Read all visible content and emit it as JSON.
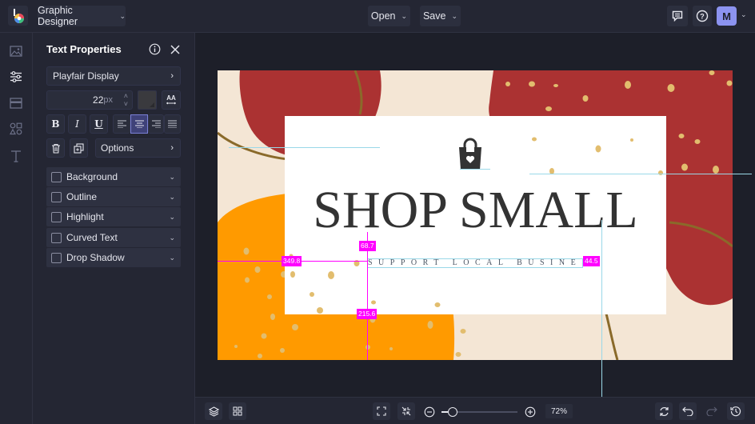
{
  "topbar": {
    "logo_icon": "befunky-logo-icon",
    "mode_label": "Graphic Designer",
    "open_label": "Open",
    "save_label": "Save",
    "avatar_initial": "M"
  },
  "iconbar": {
    "items": [
      "image-icon",
      "sliders-icon",
      "layout-icon",
      "shapes-icon",
      "text-icon"
    ]
  },
  "panel": {
    "title": "Text Properties",
    "font_family": "Playfair Display",
    "font_size_value": "22",
    "font_size_unit": "px",
    "format_buttons": [
      "B",
      "I",
      "U"
    ],
    "options_label": "Options",
    "accordions": [
      {
        "label": "Background",
        "checked": false
      },
      {
        "label": "Outline",
        "checked": false
      },
      {
        "label": "Highlight",
        "checked": false
      },
      {
        "label": "Curved Text",
        "checked": false
      },
      {
        "label": "Drop Shadow",
        "checked": false
      }
    ]
  },
  "design": {
    "headline": "SHOP SMALL",
    "subline": "SUPPORT LOCAL BUSINESS",
    "colors": {
      "background": "#f4e6d5",
      "red": "#ab3232",
      "orange": "#ff9a00",
      "dots": "#e2bd6e",
      "gold": "#8a6a2a",
      "card": "#ffffff",
      "text": "#333333"
    },
    "measurements": {
      "top": "68.7",
      "left": "349.8",
      "right": "44.5",
      "bottom": "215.6"
    }
  },
  "bottombar": {
    "zoom_percent": "72%",
    "zoom_level": 0.1
  }
}
